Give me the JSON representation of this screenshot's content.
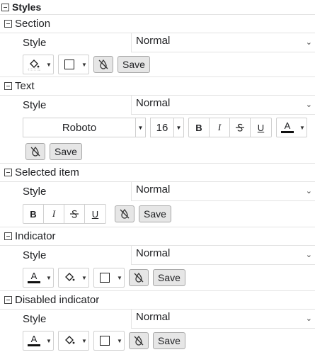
{
  "title": "Styles",
  "style_label": "Style",
  "normal_value": "Normal",
  "save_label": "Save",
  "sections": {
    "section": "Section",
    "text": "Text",
    "selected_item": "Selected item",
    "indicator": "Indicator",
    "disabled_indicator": "Disabled indicator"
  },
  "text_font": "Roboto",
  "text_size": "16",
  "format": {
    "bold": "B",
    "italic": "I",
    "underline": "U",
    "font_color_glyph": "A"
  }
}
